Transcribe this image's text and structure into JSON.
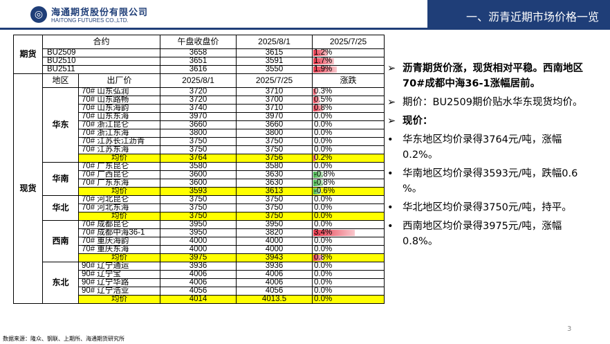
{
  "header": {
    "logo_cn": "海通期货股份有限公司",
    "logo_en": "HAITONG FUTURES CO.,LTD.",
    "title": "一、沥青近期市场价格一览"
  },
  "table": {
    "futures_header": [
      "合约",
      "午盘收盘价",
      "2025/8/1",
      "2025/7/25",
      "涨跌"
    ],
    "futures_label": "期货",
    "futures_rows": [
      {
        "name": "BU2509",
        "close": "3658",
        "prev": "3615",
        "pct": "1.2%",
        "v": 1.2
      },
      {
        "name": "BU2510",
        "close": "3651",
        "prev": "3591",
        "pct": "1.7%",
        "v": 1.7
      },
      {
        "name": "BU2511",
        "close": "3616",
        "prev": "3550",
        "pct": "1.9%",
        "v": 1.9
      }
    ],
    "spot_header": [
      "地区",
      "出厂价",
      "2025/8/1",
      "2025/7/25",
      "涨跌"
    ],
    "spot_label": "现货",
    "regions": [
      {
        "region": "华东",
        "rows": [
          {
            "name": "70# 山东弘润",
            "d1": "3720",
            "d2": "3710",
            "pct": "0.3%",
            "v": 0.3
          },
          {
            "name": "70# 山东路畅",
            "d1": "3720",
            "d2": "3700",
            "pct": "0.5%",
            "v": 0.5
          },
          {
            "name": "70# 山东海韵",
            "d1": "3740",
            "d2": "3710",
            "pct": "0.8%",
            "v": 0.8
          },
          {
            "name": "70# 山东东海",
            "d1": "3970",
            "d2": "3970",
            "pct": "0.0%",
            "v": 0
          },
          {
            "name": "70# 浙江昆仑",
            "d1": "3660",
            "d2": "3660",
            "pct": "0.0%",
            "v": 0
          },
          {
            "name": "70# 浙江东海",
            "d1": "3800",
            "d2": "3800",
            "pct": "0.0%",
            "v": 0
          },
          {
            "name": "70# 江苏长江沥青",
            "d1": "3750",
            "d2": "3750",
            "pct": "0.0%",
            "v": 0
          },
          {
            "name": "70# 江苏东海",
            "d1": "3750",
            "d2": "3750",
            "pct": "0.0%",
            "v": 0
          }
        ],
        "avg": {
          "name": "均价",
          "d1": "3764",
          "d2": "3756",
          "pct": "0.2%",
          "v": 0.2
        }
      },
      {
        "region": "华南",
        "rows": [
          {
            "name": "70# 广东昆仑",
            "d1": "3580",
            "d2": "3580",
            "pct": "0.0%",
            "v": 0
          },
          {
            "name": "70# 广西昆仑",
            "d1": "3600",
            "d2": "3630",
            "pct": "-0.8%",
            "v": -0.8
          },
          {
            "name": "70# 广东东海",
            "d1": "3600",
            "d2": "3630",
            "pct": "-0.8%",
            "v": -0.8
          }
        ],
        "avg": {
          "name": "均价",
          "d1": "3593",
          "d2": "3613",
          "pct": "-0.6%",
          "v": -0.6
        }
      },
      {
        "region": "华北",
        "rows": [
          {
            "name": "70# 河北昆仑",
            "d1": "3750",
            "d2": "3750",
            "pct": "0.0%",
            "v": 0
          },
          {
            "name": "70# 河北东海",
            "d1": "3750",
            "d2": "3750",
            "pct": "0.0%",
            "v": 0
          }
        ],
        "avg": {
          "name": "均价",
          "d1": "3750",
          "d2": "3750",
          "pct": "0.0%",
          "v": 0
        }
      },
      {
        "region": "西南",
        "rows": [
          {
            "name": "70# 成都昆仑",
            "d1": "3950",
            "d2": "3950",
            "pct": "0.0%",
            "v": 0
          },
          {
            "name": "70# 成都中海36-1",
            "d1": "3950",
            "d2": "3820",
            "pct": "3.4%",
            "v": 3.4
          },
          {
            "name": "70# 重庆海韵",
            "d1": "4000",
            "d2": "4000",
            "pct": "0.0%",
            "v": 0
          },
          {
            "name": "70# 重庆东海",
            "d1": "4000",
            "d2": "4000",
            "pct": "0.0%",
            "v": 0
          }
        ],
        "avg": {
          "name": "均价",
          "d1": "3975",
          "d2": "3943",
          "pct": "0.8%",
          "v": 0.8
        }
      },
      {
        "region": "东北",
        "rows": [
          {
            "name": "90# 辽宁通运",
            "d1": "3936",
            "d2": "3936",
            "pct": "0.0%",
            "v": 0
          },
          {
            "name": "90# 辽宁宝",
            "d1": "4006",
            "d2": "4006",
            "pct": "0.0%",
            "v": 0
          },
          {
            "name": "90# 辽宁华路",
            "d1": "4006",
            "d2": "4006",
            "pct": "0.0%",
            "v": 0
          },
          {
            "name": "90# 辽宁浩业",
            "d1": "4056",
            "d2": "4056",
            "pct": "0.0%",
            "v": 0
          }
        ],
        "avg": {
          "name": "均价",
          "d1": "4014",
          "d2": "4013.5",
          "pct": "0.0%",
          "v": 0
        }
      }
    ]
  },
  "notes": [
    {
      "marker": "➢",
      "text": "沥青期货价涨，现货相对平稳。西南地区70#成都中海36-1涨幅居前。",
      "bold": true
    },
    {
      "marker": "➢",
      "text": "期价：BU2509期价贴水华东现货均价。",
      "bold": false,
      "lead": "期价："
    },
    {
      "marker": "➢",
      "text": "现价：",
      "bold": true
    },
    {
      "marker": "•",
      "text": "华东地区均价录得3764元/吨，涨幅0.2%。",
      "bold": false
    },
    {
      "marker": "•",
      "text": "华南地区均价录得3593元/吨，跌幅0.6 %。",
      "bold": false
    },
    {
      "marker": "•",
      "text": "华北地区均价录得3750元/吨，持平。",
      "bold": false
    },
    {
      "marker": "•",
      "text": "西南地区均价录得3975元/吨，涨幅0.8%。",
      "bold": false
    }
  ],
  "footer": "数据来源：隆众、钢联、上期所、海通期货研究所",
  "page_number": "3"
}
